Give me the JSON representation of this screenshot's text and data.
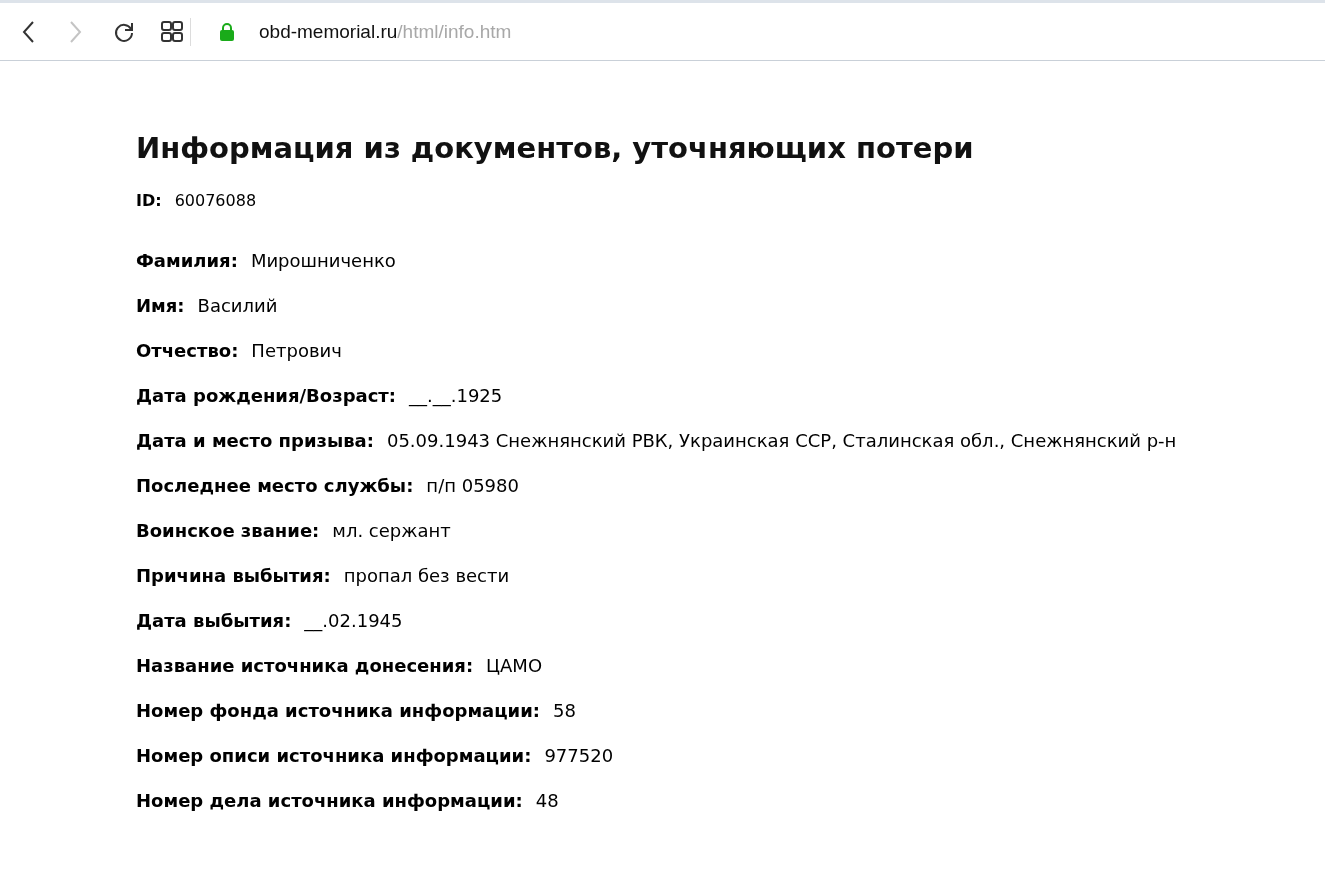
{
  "browser": {
    "back_disabled": false,
    "forward_disabled": true,
    "url_host": "obd-memorial.ru",
    "url_path": "/html/info.htm"
  },
  "page": {
    "title": "Информация из документов, уточняющих потери",
    "id_label": "ID:",
    "id_value": "60076088",
    "fields": [
      {
        "label": "Фамилия:",
        "value": "Мирошниченко"
      },
      {
        "label": "Имя:",
        "value": "Василий"
      },
      {
        "label": "Отчество:",
        "value": "Петрович"
      },
      {
        "label": "Дата рождения/Возраст:",
        "value": "__.__.1925"
      },
      {
        "label": "Дата и место призыва:",
        "value": "05.09.1943 Снежнянский РВК, Украинская ССР, Сталинская обл., Снежнянский р-н"
      },
      {
        "label": "Последнее место службы:",
        "value": "п/п 05980"
      },
      {
        "label": "Воинское звание:",
        "value": "мл. сержант"
      },
      {
        "label": "Причина выбытия:",
        "value": "пропал без вести"
      },
      {
        "label": "Дата выбытия:",
        "value": "__.02.1945"
      },
      {
        "label": "Название источника донесения:",
        "value": "ЦАМО"
      },
      {
        "label": "Номер фонда источника информации:",
        "value": "58"
      },
      {
        "label": "Номер описи источника информации:",
        "value": "977520"
      },
      {
        "label": "Номер дела источника информации:",
        "value": "48"
      }
    ]
  }
}
